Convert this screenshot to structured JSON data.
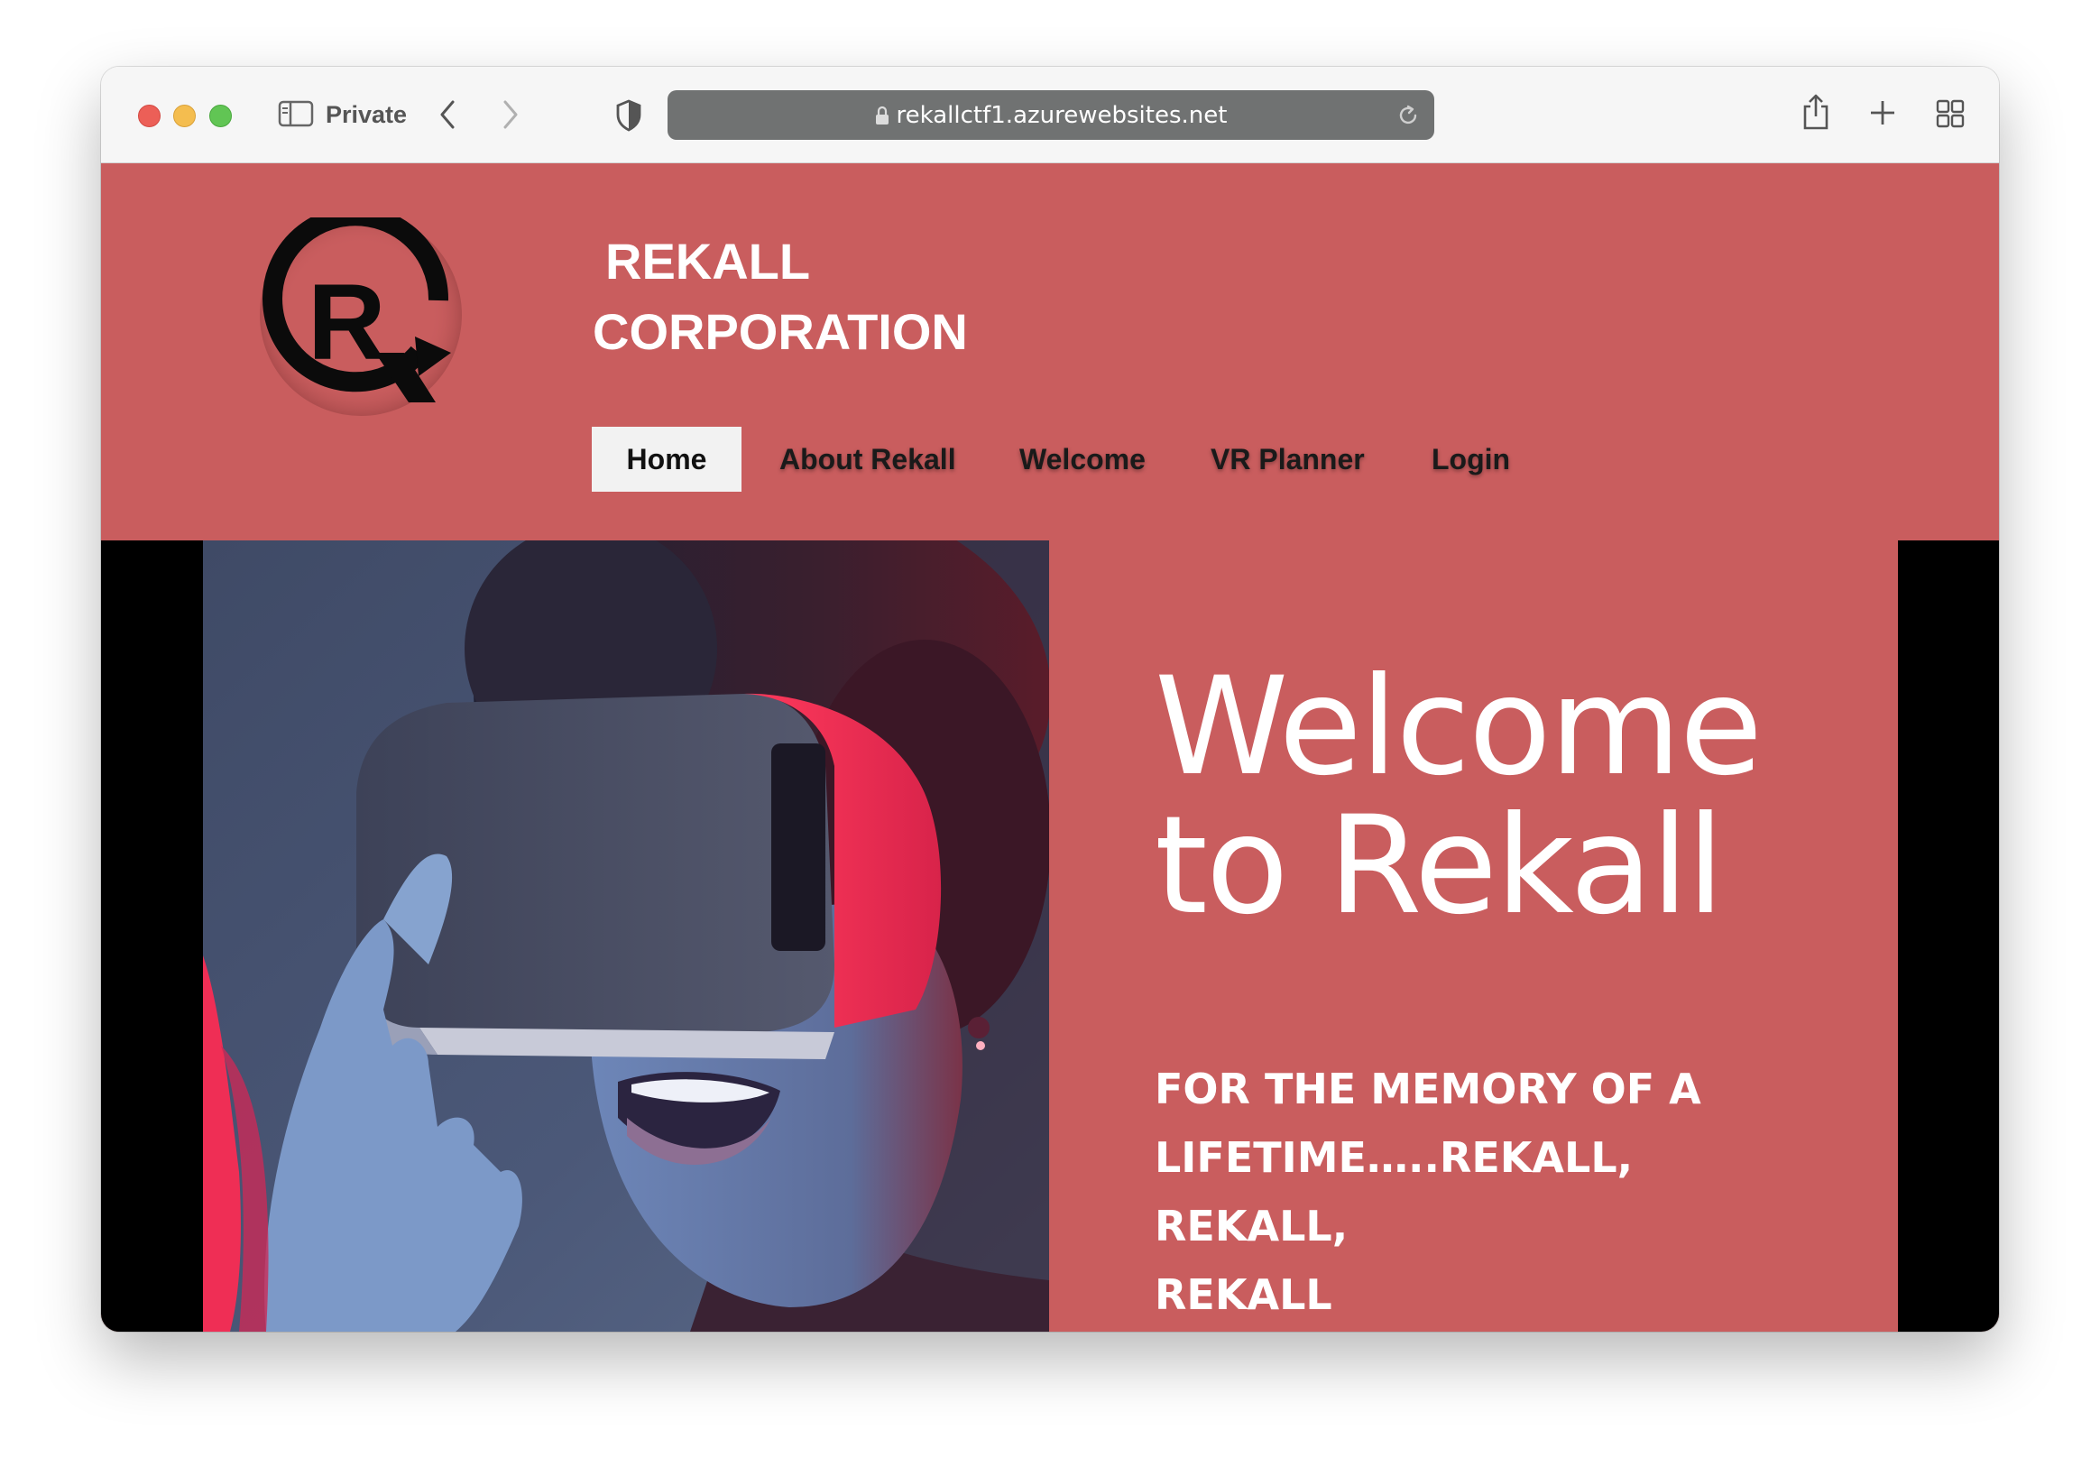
{
  "browser": {
    "mode_label": "Private",
    "url": "rekallctf1.azurewebsites.net"
  },
  "site": {
    "brand_line1": "REKALL",
    "brand_line2": "CORPORATION",
    "logo_icon": "rekall-r-logo-icon"
  },
  "nav": {
    "items": [
      {
        "label": "Home",
        "active": true
      },
      {
        "label": "About Rekall",
        "active": false
      },
      {
        "label": "Welcome",
        "active": false
      },
      {
        "label": "VR Planner",
        "active": false
      },
      {
        "label": "Login",
        "active": false
      }
    ]
  },
  "hero": {
    "headline_line1": "Welcome",
    "headline_line2": "to Rekall",
    "tagline_line1": "FOR THE MEMORY OF A",
    "tagline_line2": "LIFETIME…..REKALL, REKALL,",
    "tagline_line3": "REKALL",
    "image_subject": "woman-wearing-vr-headset"
  },
  "colors": {
    "brand_red": "#c95d5e",
    "nav_active_bg": "#f2f2f2",
    "hero_side_bars": "#000000"
  }
}
